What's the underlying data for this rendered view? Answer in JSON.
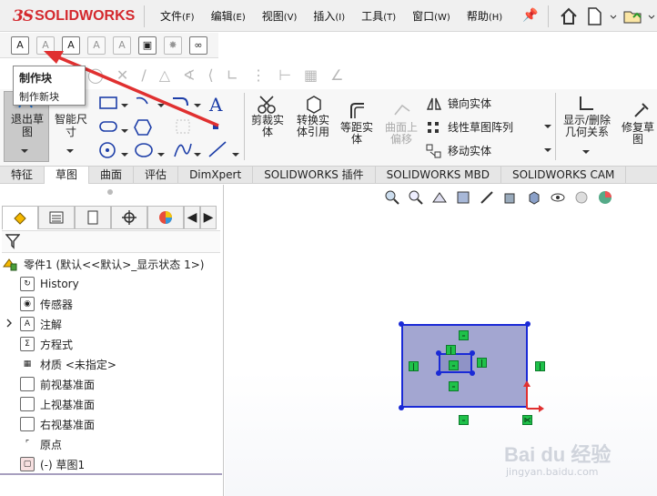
{
  "app": {
    "logo_mark": "3S",
    "logo_text": "SOLIDWORKS"
  },
  "menu": [
    {
      "label": "文件",
      "key": "(F)"
    },
    {
      "label": "编辑",
      "key": "(E)"
    },
    {
      "label": "视图",
      "key": "(V)"
    },
    {
      "label": "插入",
      "key": "(I)"
    },
    {
      "label": "工具",
      "key": "(T)"
    },
    {
      "label": "窗口",
      "key": "(W)"
    },
    {
      "label": "帮助",
      "key": "(H)"
    }
  ],
  "tooltip": {
    "title": "制作块",
    "desc": "制作新块"
  },
  "command": {
    "exit_sketch": "退出草图",
    "smart_dim": "智能尺寸",
    "trim": "剪裁实体",
    "convert": "转换实体引用",
    "offset": "等距实体",
    "surface_offset": "曲面上偏移",
    "mirror": "镜向实体",
    "linear_pattern": "线性草图阵列",
    "move": "移动实体",
    "display_relations": "显示/删除几何关系",
    "repair": "修复草图"
  },
  "tabs": [
    "特征",
    "草图",
    "曲面",
    "评估",
    "DimXpert",
    "SOLIDWORKS 插件",
    "SOLIDWORKS MBD",
    "SOLIDWORKS CAM"
  ],
  "active_tab_index": 1,
  "tree": {
    "root": "零件1 (默认<<默认>_显示状态 1>)",
    "items": [
      {
        "label": "History",
        "icon": "history-icon"
      },
      {
        "label": "传感器",
        "icon": "sensor-icon"
      },
      {
        "label": "注解",
        "icon": "annotation-icon"
      },
      {
        "label": "方程式",
        "icon": "equation-icon"
      },
      {
        "label": "材质 <未指定>",
        "icon": "material-icon"
      },
      {
        "label": "前视基准面",
        "icon": "plane-icon"
      },
      {
        "label": "上视基准面",
        "icon": "plane-icon"
      },
      {
        "label": "右视基准面",
        "icon": "plane-icon"
      },
      {
        "label": "原点",
        "icon": "origin-icon"
      },
      {
        "label": "(-) 草图1",
        "icon": "sketch-icon"
      }
    ]
  },
  "watermark": {
    "logo": "Bai du 经验",
    "sub": "jingyan.baidu.com"
  },
  "colors": {
    "sketch_line": "#1a2ad6",
    "sketch_fill": "#a3a6d1",
    "relation": "#1fc14a",
    "arrow": "#e03030",
    "brand": "#d4292e"
  }
}
